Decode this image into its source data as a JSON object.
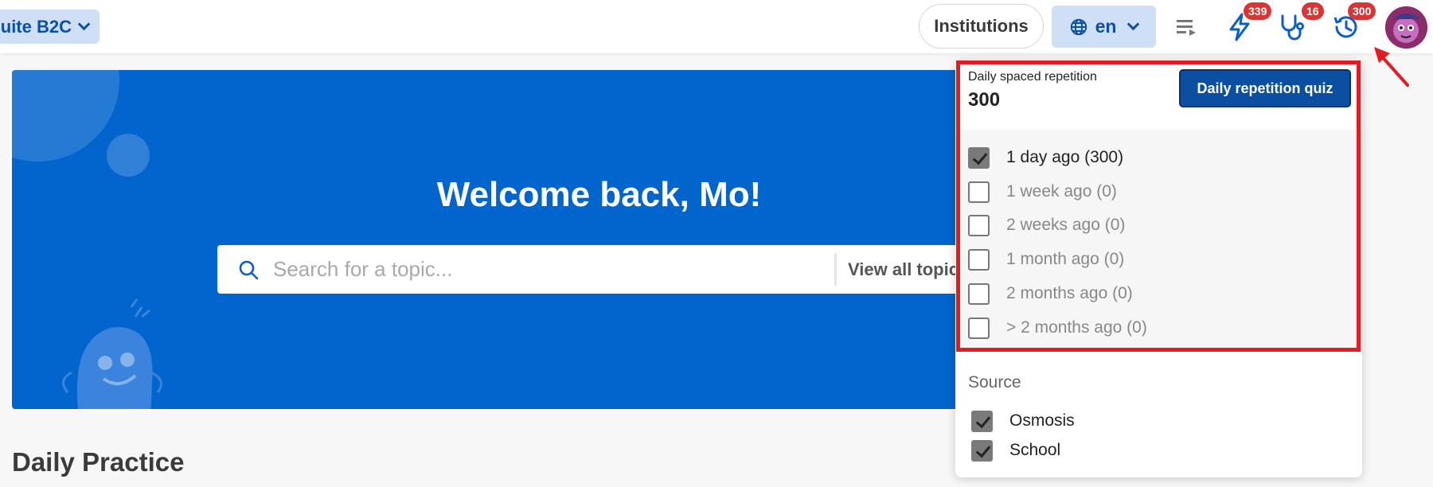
{
  "topbar": {
    "workspace_label": "uite B2C",
    "institutions_label": "Institutions",
    "language_label": "en",
    "icons": [
      {
        "name": "lightning-icon",
        "badge": "339"
      },
      {
        "name": "stethoscope-icon",
        "badge": "16"
      },
      {
        "name": "history-icon",
        "badge": "300"
      }
    ],
    "colors": {
      "accent": "#0265cd",
      "badge": "#d93535",
      "highlight": "#e51b24"
    }
  },
  "hero": {
    "welcome": "Welcome back, Mo!",
    "search_placeholder": "Search for a topic...",
    "view_all": "View all topics"
  },
  "section_title": "Daily Practice",
  "dropdown": {
    "label": "Daily spaced repetition",
    "count": "300",
    "quiz_button": "Daily repetition quiz",
    "ranges": [
      {
        "label": "1 day ago (300)",
        "checked": true
      },
      {
        "label": "1 week ago (0)",
        "checked": false
      },
      {
        "label": "2 weeks ago (0)",
        "checked": false
      },
      {
        "label": "1 month ago (0)",
        "checked": false
      },
      {
        "label": "2 months ago (0)",
        "checked": false
      },
      {
        "label": "> 2 months ago (0)",
        "checked": false
      }
    ],
    "source_title": "Source",
    "sources": [
      {
        "label": "Osmosis",
        "checked": true
      },
      {
        "label": "School",
        "checked": true
      }
    ]
  }
}
